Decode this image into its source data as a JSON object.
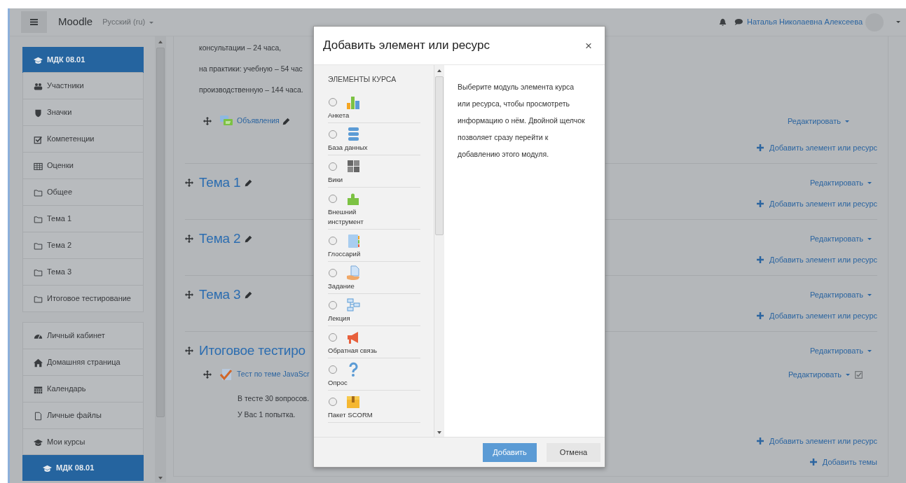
{
  "navbar": {
    "brand": "Moodle",
    "language": "Русский (ru)",
    "user": "Наталья Николаевна Алексеева"
  },
  "sidebar": {
    "groups": [
      {
        "items": [
          {
            "label": "МДК 08.01",
            "kind": "cap",
            "selected": true
          },
          {
            "label": "Участники",
            "kind": "users",
            "selected": false
          },
          {
            "label": "Значки",
            "kind": "shield",
            "selected": false
          },
          {
            "label": "Компетенции",
            "kind": "checkbox",
            "selected": false
          },
          {
            "label": "Оценки",
            "kind": "table",
            "selected": false
          },
          {
            "label": "Общее",
            "kind": "folder",
            "selected": false
          },
          {
            "label": "Тема 1",
            "kind": "folder",
            "selected": false
          },
          {
            "label": "Тема 2",
            "kind": "folder",
            "selected": false
          },
          {
            "label": "Тема 3",
            "kind": "folder",
            "selected": false
          },
          {
            "label": "Итоговое тестирование",
            "kind": "folder",
            "selected": false
          }
        ]
      },
      {
        "items": [
          {
            "label": "Личный кабинет",
            "kind": "dashboard",
            "selected": false
          },
          {
            "label": "Домашняя страница",
            "kind": "home",
            "selected": false
          },
          {
            "label": "Календарь",
            "kind": "calendar",
            "selected": false
          },
          {
            "label": "Личные файлы",
            "kind": "file",
            "selected": false
          },
          {
            "label": "Мои курсы",
            "kind": "cap",
            "selected": false,
            "children": [
              {
                "label": "МДК 08.01",
                "kind": "cap",
                "selected": true
              }
            ]
          }
        ]
      }
    ]
  },
  "course": {
    "sections": [
      {
        "intro": [
          "консультации – 24 часа,",
          "на практики:  учебную – 54 час",
          "производственную – 144 часа."
        ],
        "activities": [
          {
            "kind": "forum",
            "name": "Объявления",
            "rename_icon": true,
            "edit": "Редактировать",
            "completion_box": false
          }
        ],
        "add": "Добавить элемент или ресурс"
      },
      {
        "title": "Тема 1",
        "rename_icon": true,
        "edit": "Редактировать",
        "add": "Добавить элемент или ресурс"
      },
      {
        "title": "Тема 2",
        "rename_icon": true,
        "edit": "Редактировать",
        "add": "Добавить элемент или ресурс"
      },
      {
        "title": "Тема 3",
        "rename_icon": true,
        "edit": "Редактировать",
        "add": "Добавить элемент или ресурс"
      },
      {
        "title": "Итоговое тестиро",
        "rename_icon": false,
        "edit": "Редактировать",
        "activities": [
          {
            "kind": "quiz",
            "name": "Тест по теме JavaScr",
            "edit": "Редактировать",
            "completion_box": true,
            "description": [
              "В тесте 30 вопросов.",
              "У Вас 1 попытка."
            ]
          }
        ],
        "add": "Добавить элемент или ресурс"
      }
    ],
    "add_section": "Добавить темы"
  },
  "modal": {
    "title": "Добавить элемент или ресурс",
    "close": "×",
    "list_heading": "ЭЛЕМЕНТЫ КУРСА",
    "modules": [
      {
        "label": "Анкета",
        "kind": "chart",
        "selected": false
      },
      {
        "label": "База данных",
        "kind": "database",
        "selected": false
      },
      {
        "label": "Вики",
        "kind": "wiki",
        "selected": false
      },
      {
        "label": "Внешний инструмент",
        "kind": "puzzle",
        "selected": false
      },
      {
        "label": "Глоссарий",
        "kind": "glossary",
        "selected": false
      },
      {
        "label": "Задание",
        "kind": "assignment",
        "selected": false
      },
      {
        "label": "Лекция",
        "kind": "lesson",
        "selected": false
      },
      {
        "label": "Обратная связь",
        "kind": "megaphone",
        "selected": false
      },
      {
        "label": "Опрос",
        "kind": "question",
        "selected": false
      },
      {
        "label": "Пакет SCORM",
        "kind": "scorm",
        "selected": false
      }
    ],
    "help": "Выберите модуль элемента курса или ресурса, чтобы просмотреть информацию о нём. Двойной щелчок позволяет сразу перейти к добавлению этого модуля.",
    "buttons": [
      {
        "label": "Добавить",
        "kind": "primary"
      },
      {
        "label": "Отмена",
        "kind": "secondary"
      }
    ]
  }
}
